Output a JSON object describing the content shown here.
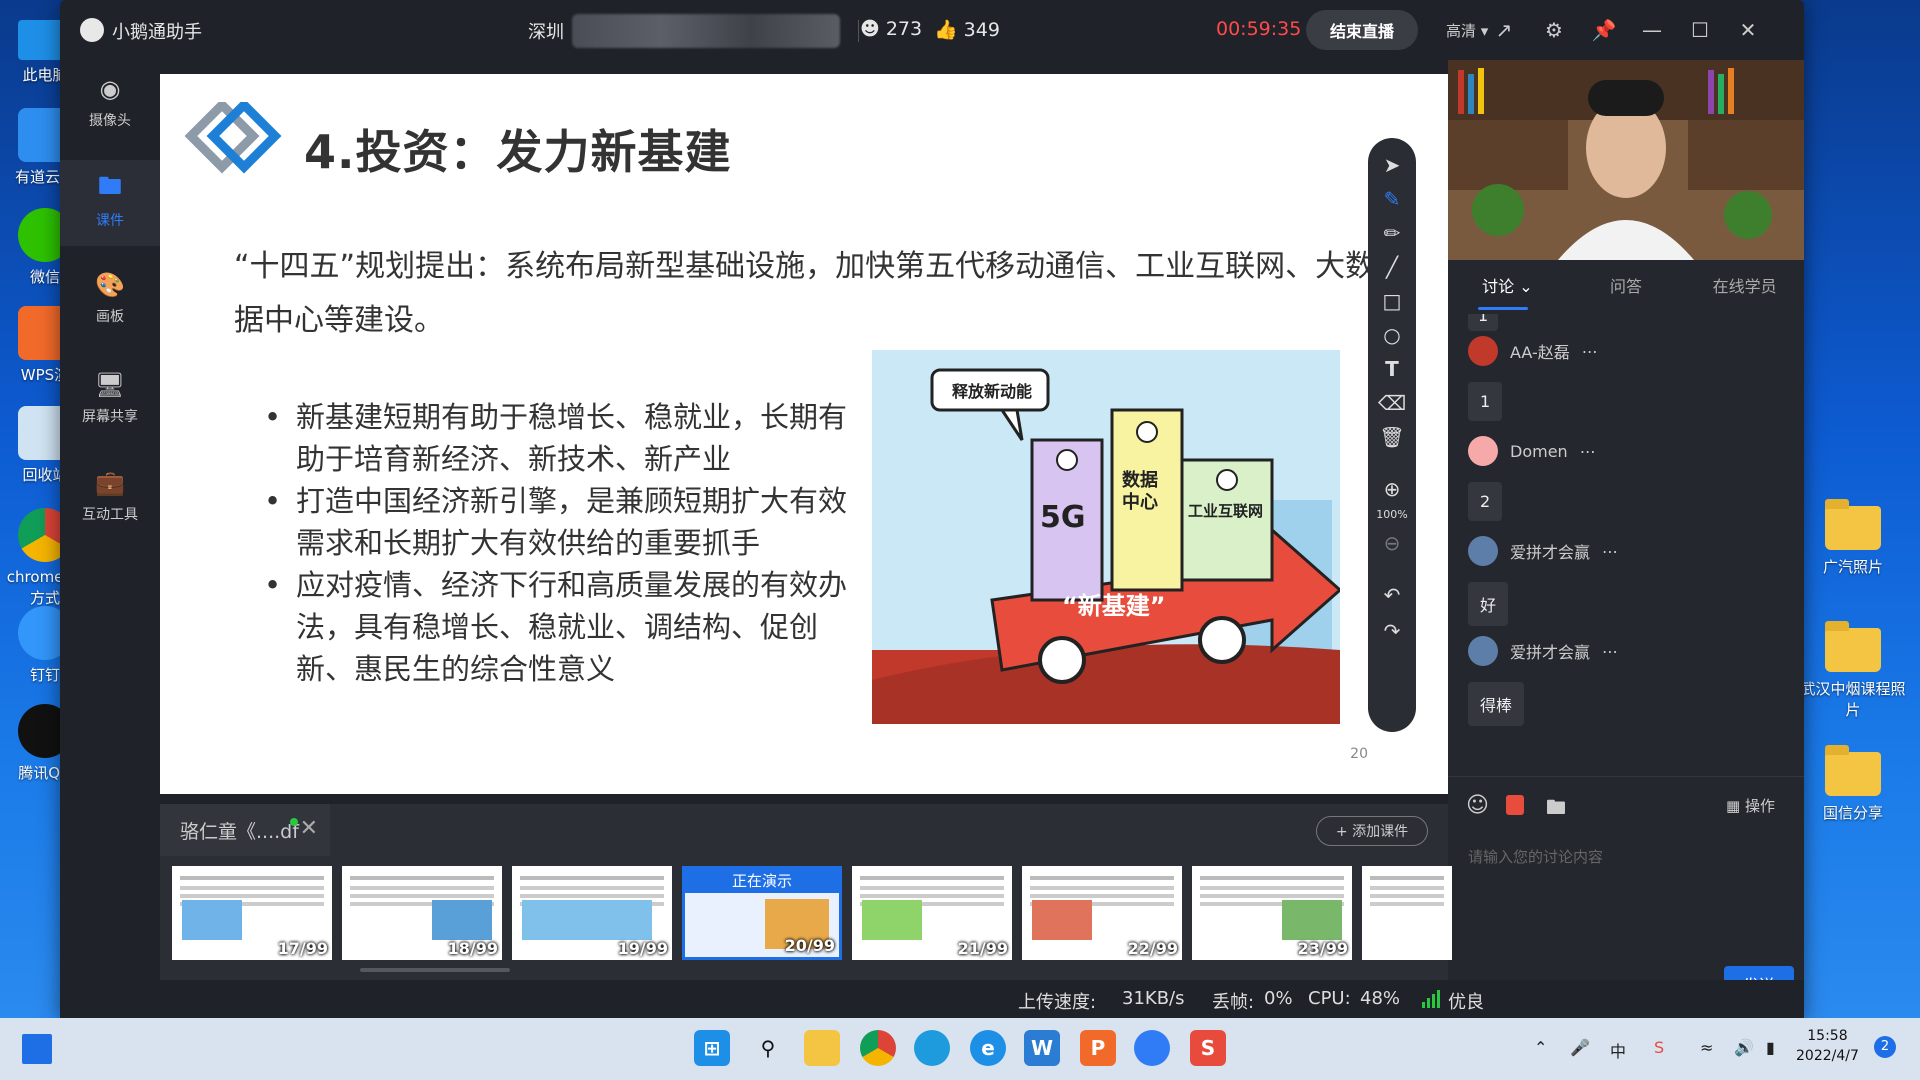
{
  "desktop": {
    "left_icons": [
      "此电脑",
      "有道云笔",
      "微信",
      "WPS演",
      "回收站",
      "chrome 捷方式",
      "钉钉",
      "腾讯QQ"
    ],
    "right_icons": [
      "广汽照片",
      "武汉中烟课程照片",
      "国信分享"
    ]
  },
  "titlebar": {
    "app_name": "小鹅通助手",
    "room_prefix": "深圳",
    "viewers": "273",
    "likes": "349",
    "timer": "00:59:35",
    "end_button": "结束直播",
    "quality": "高清"
  },
  "sidebar": {
    "items": [
      {
        "label": "摄像头",
        "icon": "camera-icon"
      },
      {
        "label": "课件",
        "icon": "folder-icon"
      },
      {
        "label": "画板",
        "icon": "palette-icon"
      },
      {
        "label": "屏幕共享",
        "icon": "screen-share-icon"
      },
      {
        "label": "互动工具",
        "icon": "toolbox-icon"
      }
    ]
  },
  "slide": {
    "title": "4.投资：发力新基建",
    "paragraph": "“十四五”规划提出：系统布局新型基础设施，加快第五代移动通信、工业互联网、大数据中心等建设。",
    "bullets": [
      "新基建短期有助于稳增长、稳就业，长期有助于培育新经济、新技术、新产业",
      "打造中国经济新引擎，是兼顾短期扩大有效需求和长期扩大有效供给的重要抓手",
      "应对疫情、经济下行和高质量发展的有效办法，具有稳增长、稳就业、调结构、促创新、惠民生的综合性意义"
    ],
    "cartoon": {
      "speech": "释放新动能",
      "building1": "5G",
      "building2": "数据中心",
      "building3": "工业互联网",
      "banner": "“新基建”"
    },
    "page_number": "20"
  },
  "annotation_tools": {
    "zoom": "100%"
  },
  "right_panel": {
    "tabs": [
      "讨论",
      "问答",
      "在线学员"
    ],
    "messages": [
      {
        "user": "AA-赵磊",
        "text": "1"
      },
      {
        "user": "Domen",
        "text": "2"
      },
      {
        "user": "爱拼才会赢",
        "text": "好"
      },
      {
        "user": "爱拼才会赢",
        "text": "得棒"
      }
    ],
    "operate_label": "操作",
    "input_placeholder": "请输入您的讨论内容",
    "send_button": "发送"
  },
  "courseware": {
    "file_tab": "骆仁童《....df",
    "add_button": "+ 添加课件",
    "now_presenting": "正在演示",
    "thumbs": [
      {
        "num": "17/99",
        "title": "3.货币政策：宽拌总量和结构双重功能"
      },
      {
        "num": "18/99",
        "title": "4.投资：发力新基建"
      },
      {
        "num": "19/99",
        "title": "4.投资：发力新基建"
      },
      {
        "num": "20/99",
        "title": ""
      },
      {
        "num": "21/99",
        "title": "5.消费：支持新能源汽车消费，鼓励绿色智能家电下乡"
      },
      {
        "num": "22/99",
        "title": "5.消费：支持新能源汽车消费，鼓励绿色智能家电下乡"
      },
      {
        "num": "23/99",
        "title": "6.创新驱动发展"
      },
      {
        "num": "",
        "title": "7.房地产：新模式，探"
      }
    ]
  },
  "statusbar": {
    "upload_label": "上传速度:",
    "upload_value": "31KB/s",
    "frame_loss_label": "丢帧:",
    "frame_loss_value": "0%",
    "cpu_label": "CPU:",
    "cpu_value": "48%",
    "quality": "优良"
  },
  "taskbar": {
    "time": "15:58",
    "date": "2022/4/7",
    "notifications": "2",
    "ime": "中"
  }
}
